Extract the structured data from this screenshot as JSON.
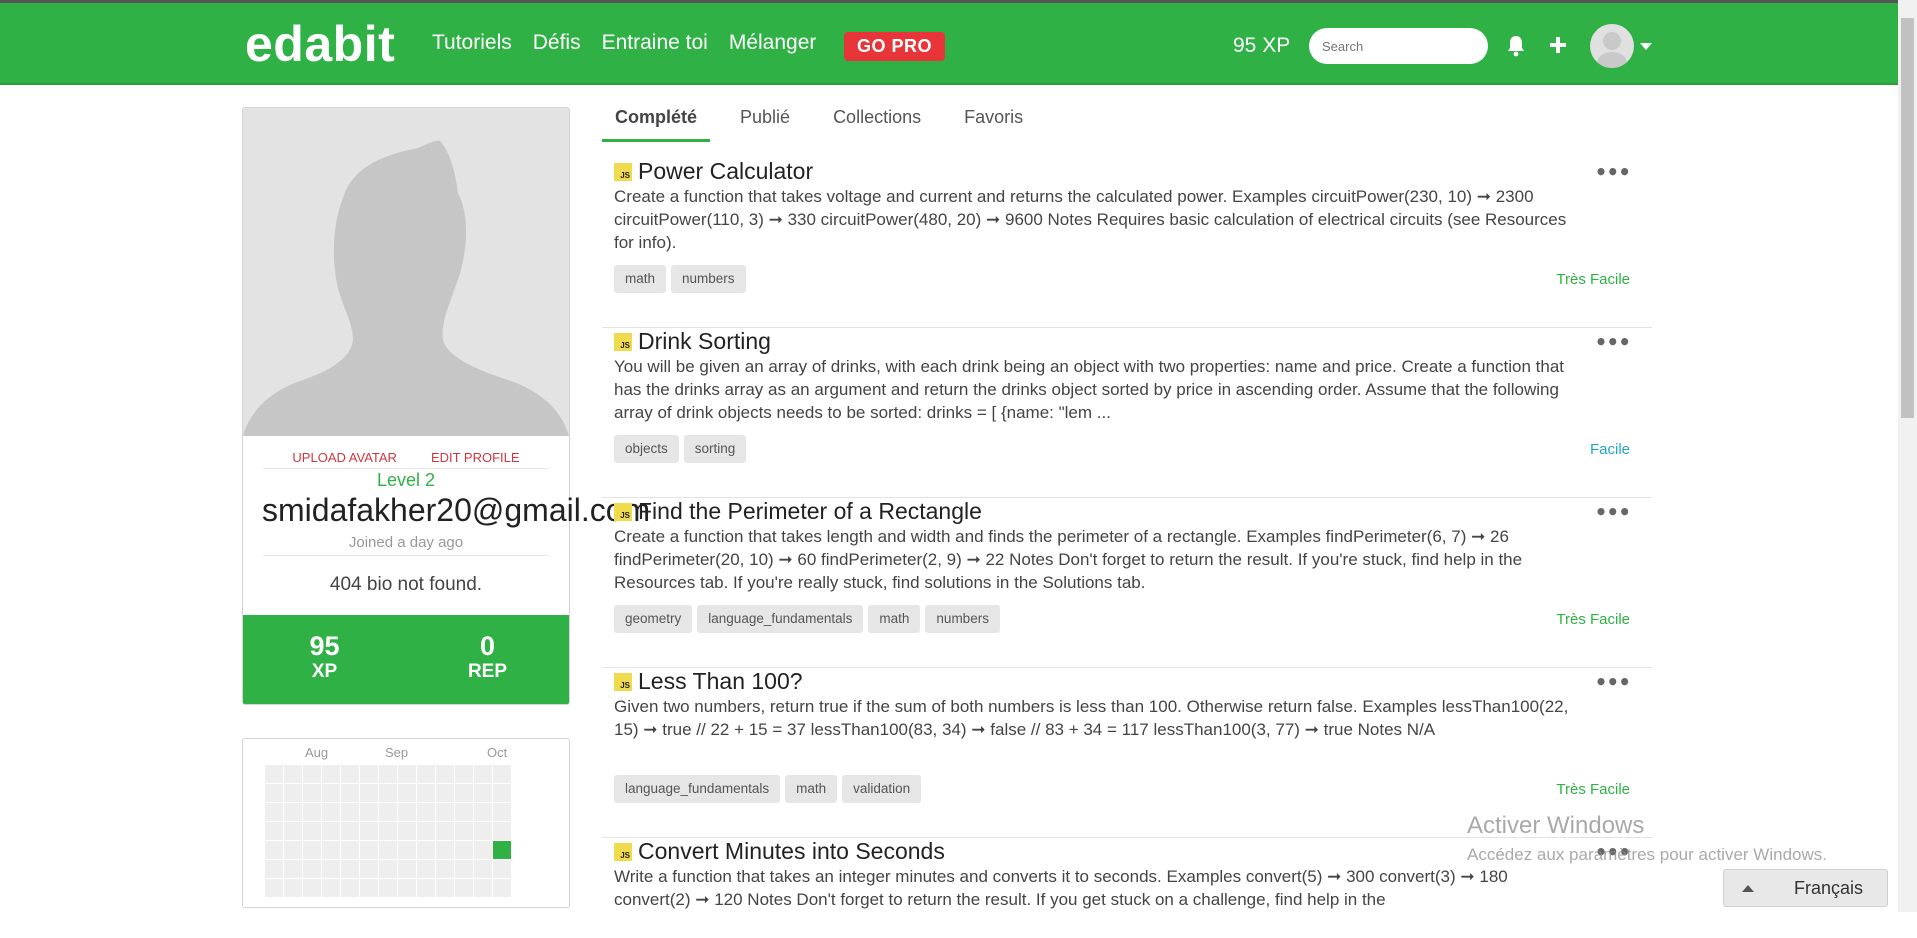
{
  "nav": {
    "logo": "edabit",
    "links": [
      "Tutoriels",
      "Défis",
      "Entraine toi",
      "Mélanger"
    ],
    "gopro": "GO PRO",
    "xp": "95 XP",
    "search_placeholder": "Search"
  },
  "profile": {
    "upload_avatar": "UPLOAD AVATAR",
    "edit_profile": "EDIT PROFILE",
    "level": "Level 2",
    "email": "smidafakher20@gmail.com",
    "joined": "Joined a day ago",
    "bio": "404 bio not found.",
    "xp_value": "95",
    "xp_label": "XP",
    "rep_value": "0",
    "rep_label": "REP"
  },
  "heatmap": {
    "months": [
      "Aug",
      "Sep",
      "Oct"
    ],
    "active_color": "#2fb145"
  },
  "tabs": [
    "Complété",
    "Publié",
    "Collections",
    "Favoris"
  ],
  "challenges": [
    {
      "lang": "JS",
      "title": "Power Calculator",
      "description": "Create a function that takes voltage and current and returns the calculated power. Examples circuitPower(230, 10) ➞ 2300 circuitPower(110, 3) ➞ 330 circuitPower(480, 20) ➞ 9600 Notes Requires basic calculation of electrical circuits (see Resources for info).",
      "tags": [
        "math",
        "numbers"
      ],
      "difficulty": "Très Facile",
      "difficulty_color": "#2fb145"
    },
    {
      "lang": "JS",
      "title": "Drink Sorting",
      "description": "You will be given an array of drinks, with each drink being an object with two properties: name and price. Create a function that has the drinks array as an argument and return the drinks object sorted by price in ascending order. Assume that the following array of drink objects needs to be sorted: drinks = [ {name: \"lem ...",
      "tags": [
        "objects",
        "sorting"
      ],
      "difficulty": "Facile",
      "difficulty_color": "#23a6c5"
    },
    {
      "lang": "JS",
      "title": "Find the Perimeter of a Rectangle",
      "description": "Create a function that takes length and width and finds the perimeter of a rectangle. Examples findPerimeter(6, 7) ➞ 26 findPerimeter(20, 10) ➞ 60 findPerimeter(2, 9) ➞ 22 Notes Don't forget to return the result. If you're stuck, find help in the Resources tab. If you're really stuck, find solutions in the Solutions tab.",
      "tags": [
        "geometry",
        "language_fundamentals",
        "math",
        "numbers"
      ],
      "difficulty": "Très Facile",
      "difficulty_color": "#2fb145"
    },
    {
      "lang": "JS",
      "title": "Less Than 100?",
      "description": "Given two numbers, return true if the sum of both numbers is less than 100. Otherwise return false. Examples lessThan100(22, 15) ➞ true // 22 + 15 = 37 lessThan100(83, 34) ➞ false // 83 + 34 = 117 lessThan100(3, 77) ➞ true Notes N/A",
      "tags": [
        "language_fundamentals",
        "math",
        "validation"
      ],
      "difficulty": "Très Facile",
      "difficulty_color": "#2fb145"
    },
    {
      "lang": "JS",
      "title": "Convert Minutes into Seconds",
      "description": "Write a function that takes an integer minutes and converts it to seconds. Examples convert(5) ➞ 300 convert(3) ➞ 180 convert(2) ➞ 120 Notes Don't forget to return the result. If you get stuck on a challenge, find help in the",
      "tags": [],
      "difficulty": "",
      "difficulty_color": "#2fb145"
    }
  ],
  "watermark": {
    "line1": "Activer Windows",
    "line2": "Accédez aux paramètres pour activer Windows."
  },
  "language": "Français"
}
